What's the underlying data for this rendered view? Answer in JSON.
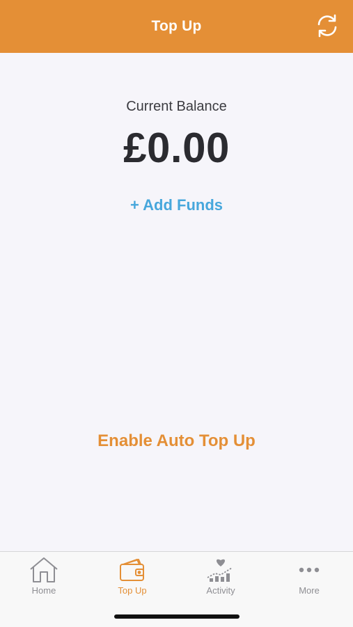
{
  "header": {
    "title": "Top Up",
    "refresh_icon": "refresh-icon"
  },
  "balance": {
    "label": "Current Balance",
    "amount": "£0.00"
  },
  "actions": {
    "add_funds": "+ Add Funds",
    "auto_top_up": "Enable Auto Top Up"
  },
  "tabbar": {
    "active": "Top Up",
    "items": [
      {
        "label": "Home",
        "icon": "home-icon"
      },
      {
        "label": "Top Up",
        "icon": "wallet-icon"
      },
      {
        "label": "Activity",
        "icon": "activity-chart-icon"
      },
      {
        "label": "More",
        "icon": "more-dots-icon"
      }
    ]
  },
  "colors": {
    "accent": "#e48f36",
    "link": "#47a7dc",
    "background": "#f6f5fa",
    "inactive": "#8e8e93"
  }
}
